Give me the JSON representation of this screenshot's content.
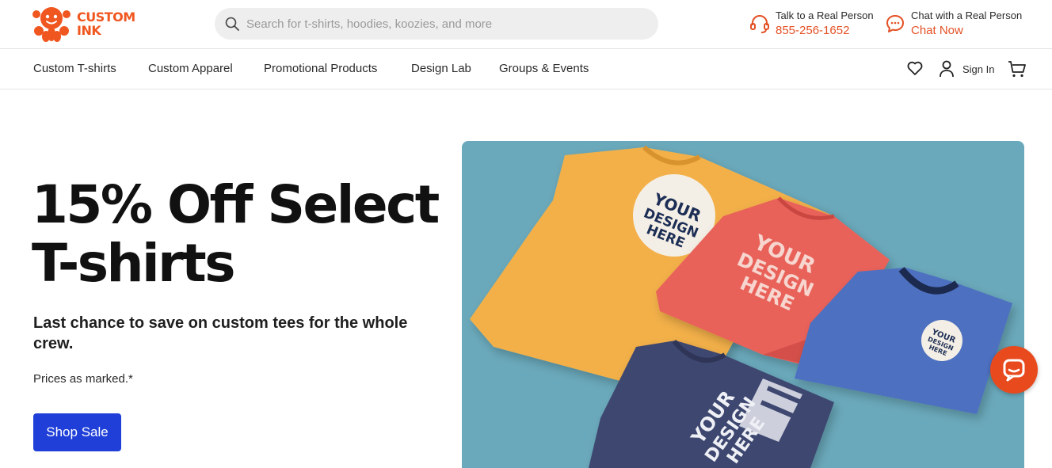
{
  "brand": {
    "name_line1": "CUSTOM",
    "name_line2": "INK",
    "accent_color": "#f0561f"
  },
  "search": {
    "placeholder": "Search for t-shirts, hoodies, koozies, and more",
    "icon": "search-icon"
  },
  "contact": {
    "phone": {
      "label": "Talk to a Real Person",
      "value": "855-256-1652",
      "icon": "headset-icon"
    },
    "chat": {
      "label": "Chat with a Real Person",
      "value": "Chat Now",
      "icon": "chat-bubble-icon"
    }
  },
  "nav": {
    "items": [
      {
        "label": "Custom T-shirts"
      },
      {
        "label": "Custom Apparel"
      },
      {
        "label": "Promotional Products"
      },
      {
        "label": "Design Lab"
      },
      {
        "label": "Groups & Events"
      }
    ],
    "signin_label": "Sign In",
    "icons": [
      "heart-icon",
      "user-icon",
      "cart-icon"
    ]
  },
  "hero": {
    "title": "15% Off Select T-shirts",
    "subtitle": "Last chance to save on custom tees for the whole crew.",
    "note": "Prices as marked.*",
    "cta_label": "Shop Sale",
    "cta_color": "#1f3fd8",
    "image": {
      "background_color": "#6aa9bb",
      "shirt_print_text": "YOUR DESIGN HERE",
      "shirt_colors": [
        "#f3b04a",
        "#e9625a",
        "#4d6fc0",
        "#3d4670"
      ]
    }
  },
  "chat_fab": {
    "icon": "chat-bubble-icon",
    "color": "#e84a1e"
  }
}
